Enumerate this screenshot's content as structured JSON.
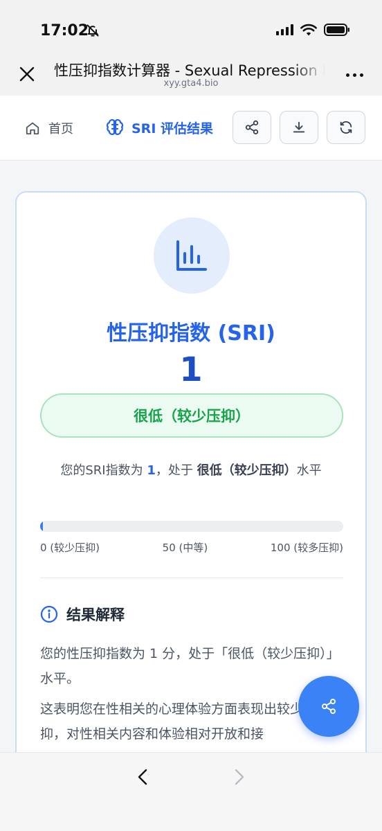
{
  "status_bar": {
    "time": "17:02"
  },
  "browser": {
    "title": "性压抑指数计算器 - Sexual Repression Index",
    "url": "xyy.gta4.bio"
  },
  "nav": {
    "home_label": "首页",
    "sri_label": "SRI 评估结果"
  },
  "result": {
    "title": "性压抑指数 (SRI)",
    "score": "1",
    "level_label": "很低（较少压抑）",
    "desc_prefix": "您的SRI指数为 ",
    "desc_score": "1",
    "desc_middle": "，处于 ",
    "desc_level": "很低（较少压抑）",
    "desc_suffix": "水平",
    "progress_percent": 1,
    "scale_min": "0 (较少压抑)",
    "scale_mid": "50 (中等)",
    "scale_max": "100 (较多压抑)"
  },
  "explanation": {
    "heading": "结果解释",
    "p1": "您的性压抑指数为 1 分，处于「很低（较少压抑）」水平。",
    "p2": "这表明您在性相关的心理体验方面表现出较少的性压抑，对性相关内容和体验相对开放和接"
  },
  "colors": {
    "accent": "#2563eb",
    "success": "#16a34a",
    "badge_bg": "#ecfbf1",
    "fab": "#3b82f6"
  },
  "icons": {
    "close": "close-icon",
    "more": "more-icon",
    "home": "home-icon",
    "brain": "brain-icon",
    "share": "share-icon",
    "download": "download-icon",
    "refresh": "refresh-icon",
    "chart": "bar-chart-icon",
    "info": "info-icon",
    "back": "chevron-left-icon",
    "forward": "chevron-right-icon"
  }
}
